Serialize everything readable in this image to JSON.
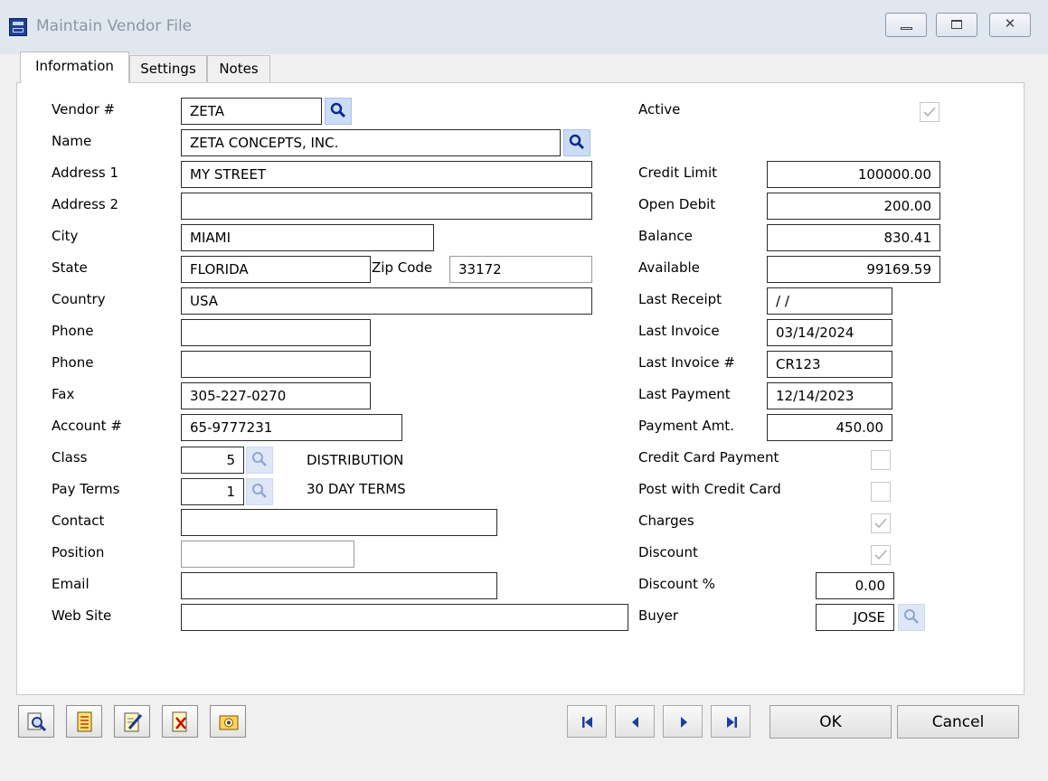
{
  "window": {
    "title": "Maintain Vendor File"
  },
  "titlebar_buttons": {
    "minimize": "",
    "maximize": "",
    "close": "✕"
  },
  "tabs": [
    "Information",
    "Settings",
    "Notes"
  ],
  "left_fields": {
    "vendor": {
      "label": "Vendor #",
      "value": "ZETA"
    },
    "name": {
      "label": "Name",
      "value": "ZETA CONCEPTS, INC."
    },
    "address1": {
      "label": "Address 1",
      "value": "MY STREET"
    },
    "address2": {
      "label": "Address 2",
      "value": ""
    },
    "city": {
      "label": "City",
      "value": "MIAMI"
    },
    "state": {
      "label": "State",
      "value": "FLORIDA"
    },
    "zip": {
      "label": "Zip Code",
      "value": "33172"
    },
    "country": {
      "label": "Country",
      "value": "USA"
    },
    "phone1": {
      "label": "Phone",
      "value": ""
    },
    "phone2": {
      "label": "Phone",
      "value": ""
    },
    "fax": {
      "label": "Fax",
      "value": "305-227-0270"
    },
    "account": {
      "label": "Account #",
      "value": "65-9777231"
    },
    "class": {
      "label": "Class",
      "value": "5",
      "description": "DISTRIBUTION"
    },
    "pay_terms": {
      "label": "Pay Terms",
      "value": "1",
      "description": "30 DAY TERMS"
    },
    "contact": {
      "label": "Contact",
      "value": ""
    },
    "position": {
      "label": "Position",
      "value": ""
    },
    "email": {
      "label": "Email",
      "value": ""
    },
    "website": {
      "label": "Web Site",
      "value": ""
    }
  },
  "right_fields": {
    "active": {
      "label": "Active",
      "checked": true
    },
    "credit_limit": {
      "label": "Credit Limit",
      "value": "100000.00"
    },
    "open_debit": {
      "label": "Open Debit",
      "value": "200.00"
    },
    "balance": {
      "label": "Balance",
      "value": "830.41"
    },
    "available": {
      "label": "Available",
      "value": "99169.59"
    },
    "last_receipt": {
      "label": "Last Receipt",
      "value": " / /"
    },
    "last_invoice": {
      "label": "Last Invoice",
      "value": "03/14/2024"
    },
    "last_invoice_no": {
      "label": "Last Invoice #",
      "value": "CR123"
    },
    "last_payment": {
      "label": "Last Payment",
      "value": "12/14/2023"
    },
    "payment_amt": {
      "label": "Payment Amt.",
      "value": "450.00"
    },
    "credit_card_payment": {
      "label": "Credit Card Payment",
      "checked": false
    },
    "post_with_credit_card": {
      "label": "Post with Credit Card",
      "checked": false
    },
    "charges": {
      "label": "Charges",
      "checked": true
    },
    "discount": {
      "label": "Discount",
      "checked": true
    },
    "discount_pct": {
      "label": "Discount %",
      "value": "0.00"
    },
    "buyer": {
      "label": "Buyer",
      "value": "JOSE"
    }
  },
  "buttons": {
    "ok": "OK",
    "cancel": "Cancel"
  },
  "colors": {
    "lookup_bg": "#cbdcf6",
    "title_text": "#8c96a3",
    "titlebar_bg": "#e1e7ef"
  }
}
